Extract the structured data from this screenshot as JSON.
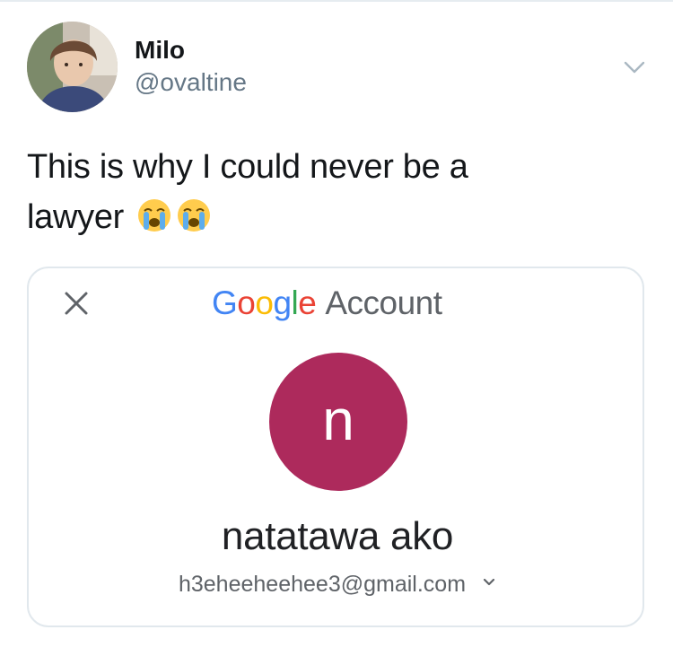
{
  "tweet": {
    "author": {
      "display_name": "Milo",
      "handle": "@ovaltine"
    },
    "text": {
      "line1": "This is why I could never be a",
      "line2": "lawyer",
      "emojis": [
        "loudly-crying-face-emoji",
        "loudly-crying-face-emoji"
      ]
    },
    "options_icon": "chevron-down-icon"
  },
  "media": {
    "google_header": {
      "google_letters": [
        {
          "char": "G",
          "color": "#4285f4"
        },
        {
          "char": "o",
          "color": "#ea4335"
        },
        {
          "char": "o",
          "color": "#fbbc05"
        },
        {
          "char": "g",
          "color": "#4285f4"
        },
        {
          "char": "l",
          "color": "#34a853"
        },
        {
          "char": "e",
          "color": "#ea4335"
        }
      ],
      "account_word": "Account",
      "close_icon": "close-icon"
    },
    "profile": {
      "initial": "n",
      "avatar_color": "#ad2a5c",
      "name": "natatawa ako",
      "email": "h3eheeheehee3@gmail.com",
      "email_dropdown_icon": "chevron-down-icon"
    }
  }
}
